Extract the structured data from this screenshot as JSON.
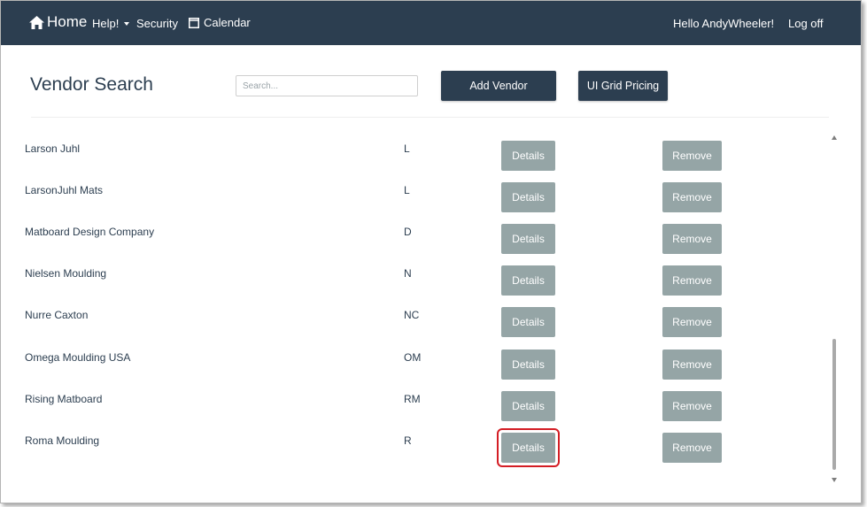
{
  "navbar": {
    "brand": "Home",
    "help": "Help!",
    "security": "Security",
    "calendar": "Calendar",
    "greeting": "Hello AndyWheeler!",
    "logoff": "Log off"
  },
  "header": {
    "title": "Vendor Search",
    "search_placeholder": "Search...",
    "add_vendor": "Add Vendor",
    "grid_pricing": "UI Grid Pricing"
  },
  "buttons": {
    "details": "Details",
    "remove": "Remove"
  },
  "vendors": [
    {
      "name": "Larson Juhl",
      "code": "L"
    },
    {
      "name": "LarsonJuhl Mats",
      "code": "L"
    },
    {
      "name": "Matboard Design Company",
      "code": "D"
    },
    {
      "name": "Nielsen Moulding",
      "code": "N"
    },
    {
      "name": "Nurre Caxton",
      "code": "NC"
    },
    {
      "name": "Omega Moulding USA",
      "code": "OM"
    },
    {
      "name": "Rising Matboard",
      "code": "RM"
    },
    {
      "name": "Roma Moulding",
      "code": "R"
    }
  ],
  "highlighted_row": 7,
  "colors": {
    "navbar": "#2c3e50",
    "primary_button": "#2c3e50",
    "secondary_button": "#95a5a6",
    "highlight": "#d41e25"
  }
}
